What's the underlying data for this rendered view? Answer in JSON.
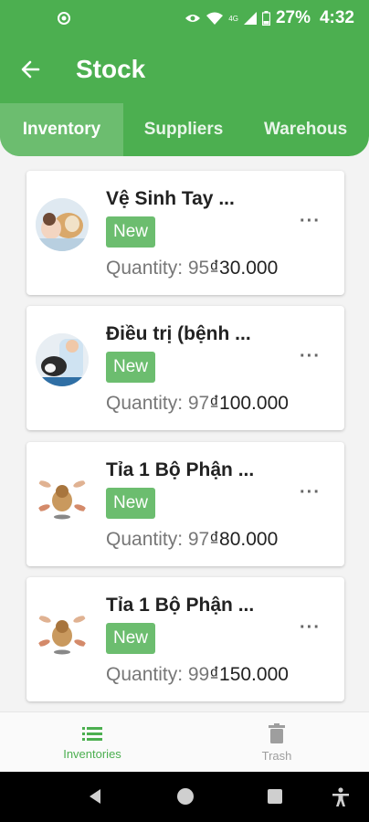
{
  "status_bar": {
    "battery": "27%",
    "time": "4:32",
    "network": "4G"
  },
  "app_bar": {
    "title": "Stock"
  },
  "tabs": [
    {
      "label": "Inventory",
      "active": true
    },
    {
      "label": "Suppliers",
      "active": false
    },
    {
      "label": "Warehous",
      "active": false
    }
  ],
  "items": [
    {
      "name": "Vệ Sinh Tay ...",
      "badge": "New",
      "quantity_label": "Quantity: 95",
      "price": "₫30.000"
    },
    {
      "name": "Điều trị (bệnh ...",
      "badge": "New",
      "quantity_label": "Quantity: 97",
      "price": "₫100.000"
    },
    {
      "name": "Tỉa 1 Bộ Phận ...",
      "badge": "New",
      "quantity_label": "Quantity: 97",
      "price": "₫80.000"
    },
    {
      "name": "Tỉa 1 Bộ Phận ...",
      "badge": "New",
      "quantity_label": "Quantity: 99",
      "price": "₫150.000"
    }
  ],
  "more_label": "···",
  "bottom_nav": [
    {
      "label": "Inventories",
      "icon": "list-icon",
      "active": true
    },
    {
      "label": "Trash",
      "icon": "trash-icon",
      "active": false
    }
  ],
  "colors": {
    "primary": "#4caf50",
    "tab_active": "#6cbd6f",
    "badge": "#6cbd6f"
  }
}
